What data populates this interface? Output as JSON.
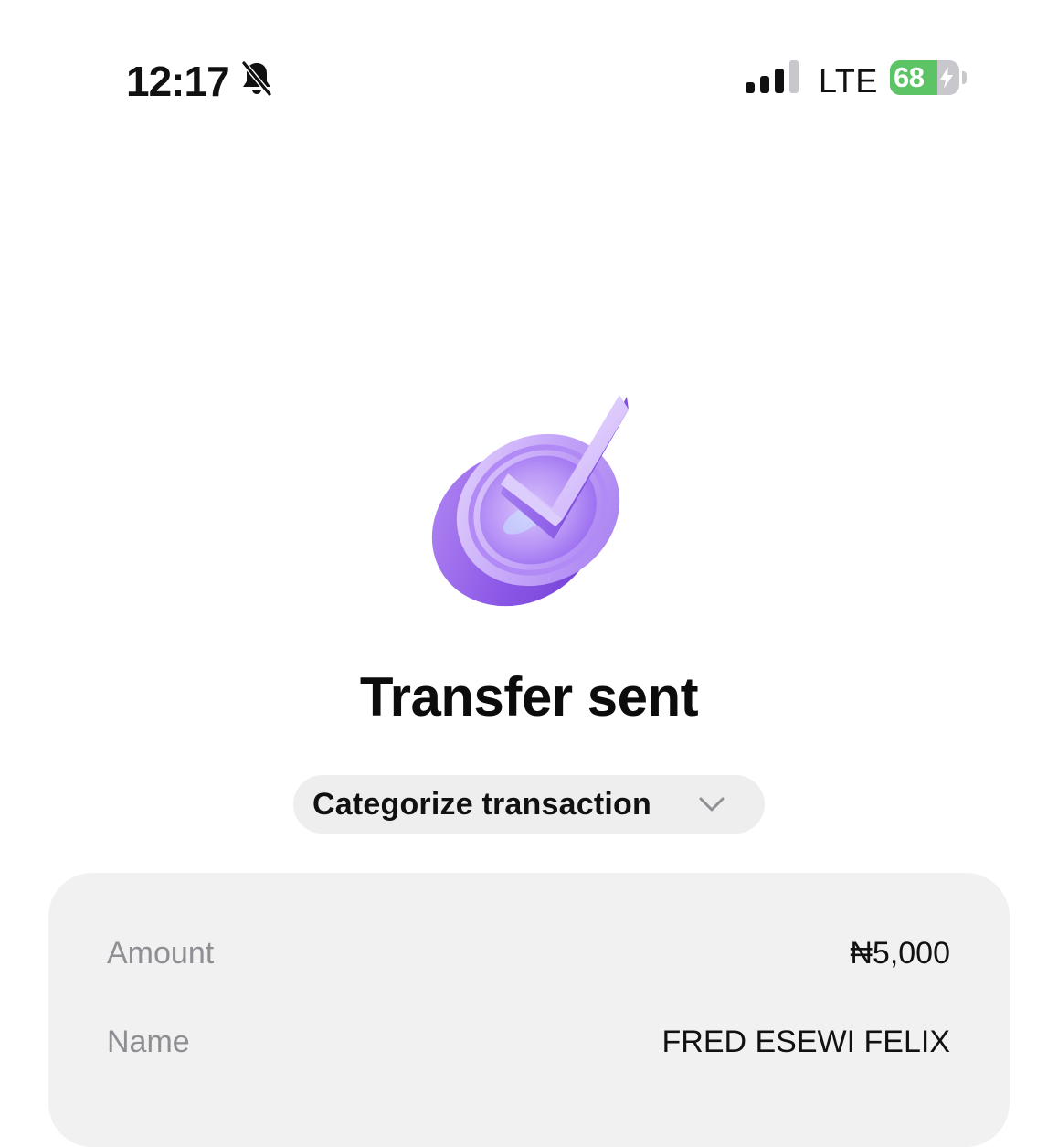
{
  "status_bar": {
    "time": "12:17",
    "muted_icon": "bell-slash-icon",
    "signal_icon": "cellular-signal-icon",
    "signal_bars": 3,
    "signal_bars_total": 4,
    "network": "LTE",
    "battery_level": "68",
    "battery_fraction": 0.68,
    "battery_charging": true,
    "battery_color": "#5dc466"
  },
  "success": {
    "icon": "purple-checkmark-coin-icon",
    "accent_color": "#9a6cf0"
  },
  "title": "Transfer sent",
  "category_chip": {
    "label": "Categorize transaction",
    "icon": "chevron-down-icon"
  },
  "details": {
    "rows": [
      {
        "label": "Amount",
        "value": "₦5,000"
      },
      {
        "label": "Name",
        "value": "FRED ESEWI FELIX"
      }
    ]
  }
}
